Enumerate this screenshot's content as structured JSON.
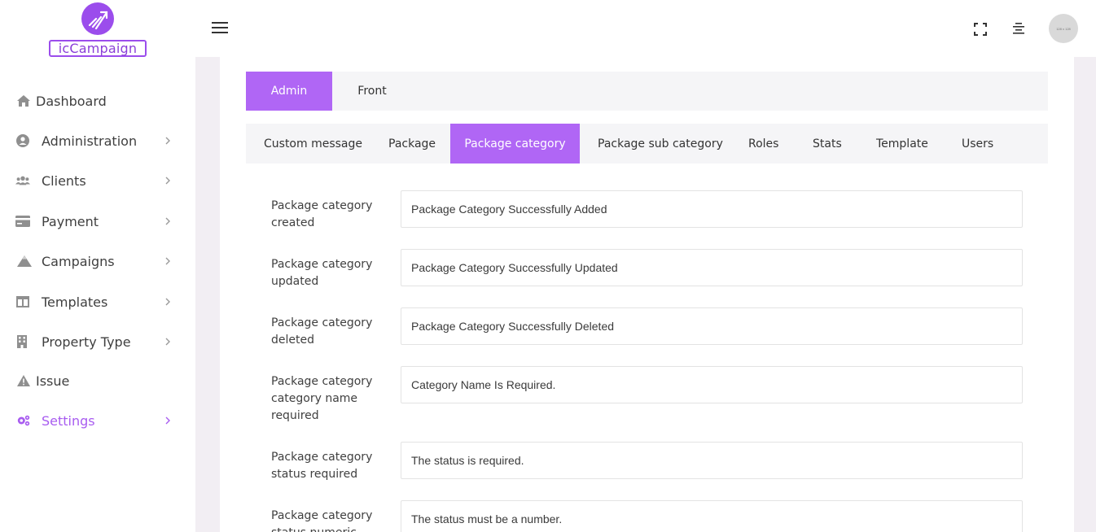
{
  "brand": {
    "logo_text": "icCampaign"
  },
  "sidebar": {
    "items": [
      {
        "label": "Dashboard",
        "icon": "home-icon",
        "has_chevron": false
      },
      {
        "label": "Administration",
        "icon": "user-circle-icon",
        "has_chevron": true
      },
      {
        "label": "Clients",
        "icon": "users-icon",
        "has_chevron": true
      },
      {
        "label": "Payment",
        "icon": "credit-card-icon",
        "has_chevron": true
      },
      {
        "label": "Campaigns",
        "icon": "mountain-icon",
        "has_chevron": true
      },
      {
        "label": "Templates",
        "icon": "layout-icon",
        "has_chevron": true
      },
      {
        "label": "Property Type",
        "icon": "building-icon",
        "has_chevron": true
      },
      {
        "label": "Issue",
        "icon": "warning-icon",
        "has_chevron": false
      },
      {
        "label": "Settings",
        "icon": "gears-icon",
        "has_chevron": true,
        "active": true
      }
    ]
  },
  "header": {
    "avatar_text": "128 x 128"
  },
  "tabs_primary": [
    {
      "label": "Admin",
      "active": true
    },
    {
      "label": "Front",
      "active": false
    }
  ],
  "tabs_secondary": [
    {
      "label": "Custom message"
    },
    {
      "label": "Package"
    },
    {
      "label": "Package category",
      "active": true
    },
    {
      "label": "Package sub category"
    },
    {
      "label": "Roles"
    },
    {
      "label": "Stats"
    },
    {
      "label": "Template"
    },
    {
      "label": "Users"
    }
  ],
  "form": {
    "rows": [
      {
        "label": "Package category created",
        "value": "Package Category Successfully Added"
      },
      {
        "label": "Package category updated",
        "value": "Package Category Successfully Updated"
      },
      {
        "label": "Package category deleted",
        "value": "Package Category Successfully Deleted"
      },
      {
        "label": "Package category category name required",
        "value": "Category Name Is Required."
      },
      {
        "label": "Package category status required",
        "value": "The status is required."
      },
      {
        "label": "Package category status numeric",
        "value": "The status must be a number."
      }
    ]
  },
  "colors": {
    "accent": "#b066f5",
    "brand": "#9b4dec",
    "page_bg": "#f2eef3"
  }
}
